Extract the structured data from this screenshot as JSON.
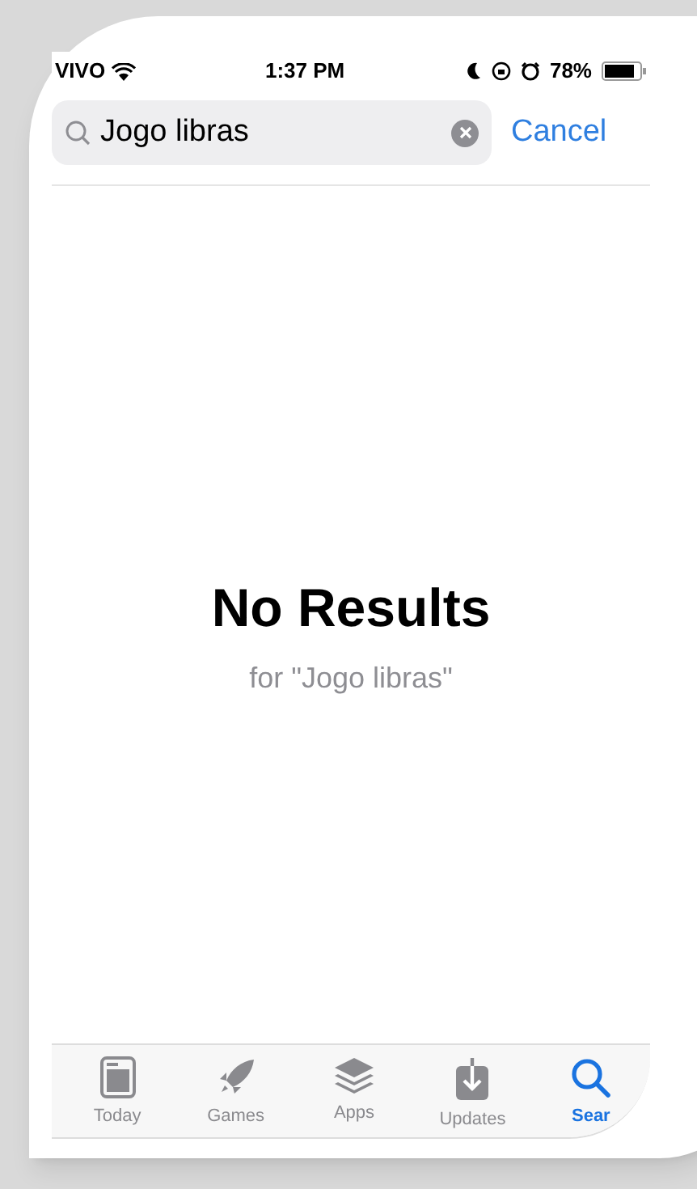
{
  "status_bar": {
    "carrier": "VIVO",
    "time": "1:37 PM",
    "battery": "78%"
  },
  "search": {
    "value": "Jogo libras",
    "cancel": "Cancel"
  },
  "empty_state": {
    "title": "No Results",
    "subtitle": "for \"Jogo libras\""
  },
  "tab_bar": [
    {
      "label": "Today",
      "kind": "today",
      "selected": false
    },
    {
      "label": "Games",
      "kind": "games",
      "selected": false
    },
    {
      "label": "Apps",
      "kind": "apps",
      "selected": false
    },
    {
      "label": "Updates",
      "kind": "updates",
      "selected": false
    },
    {
      "label": "Sear",
      "kind": "search",
      "selected": true
    }
  ]
}
